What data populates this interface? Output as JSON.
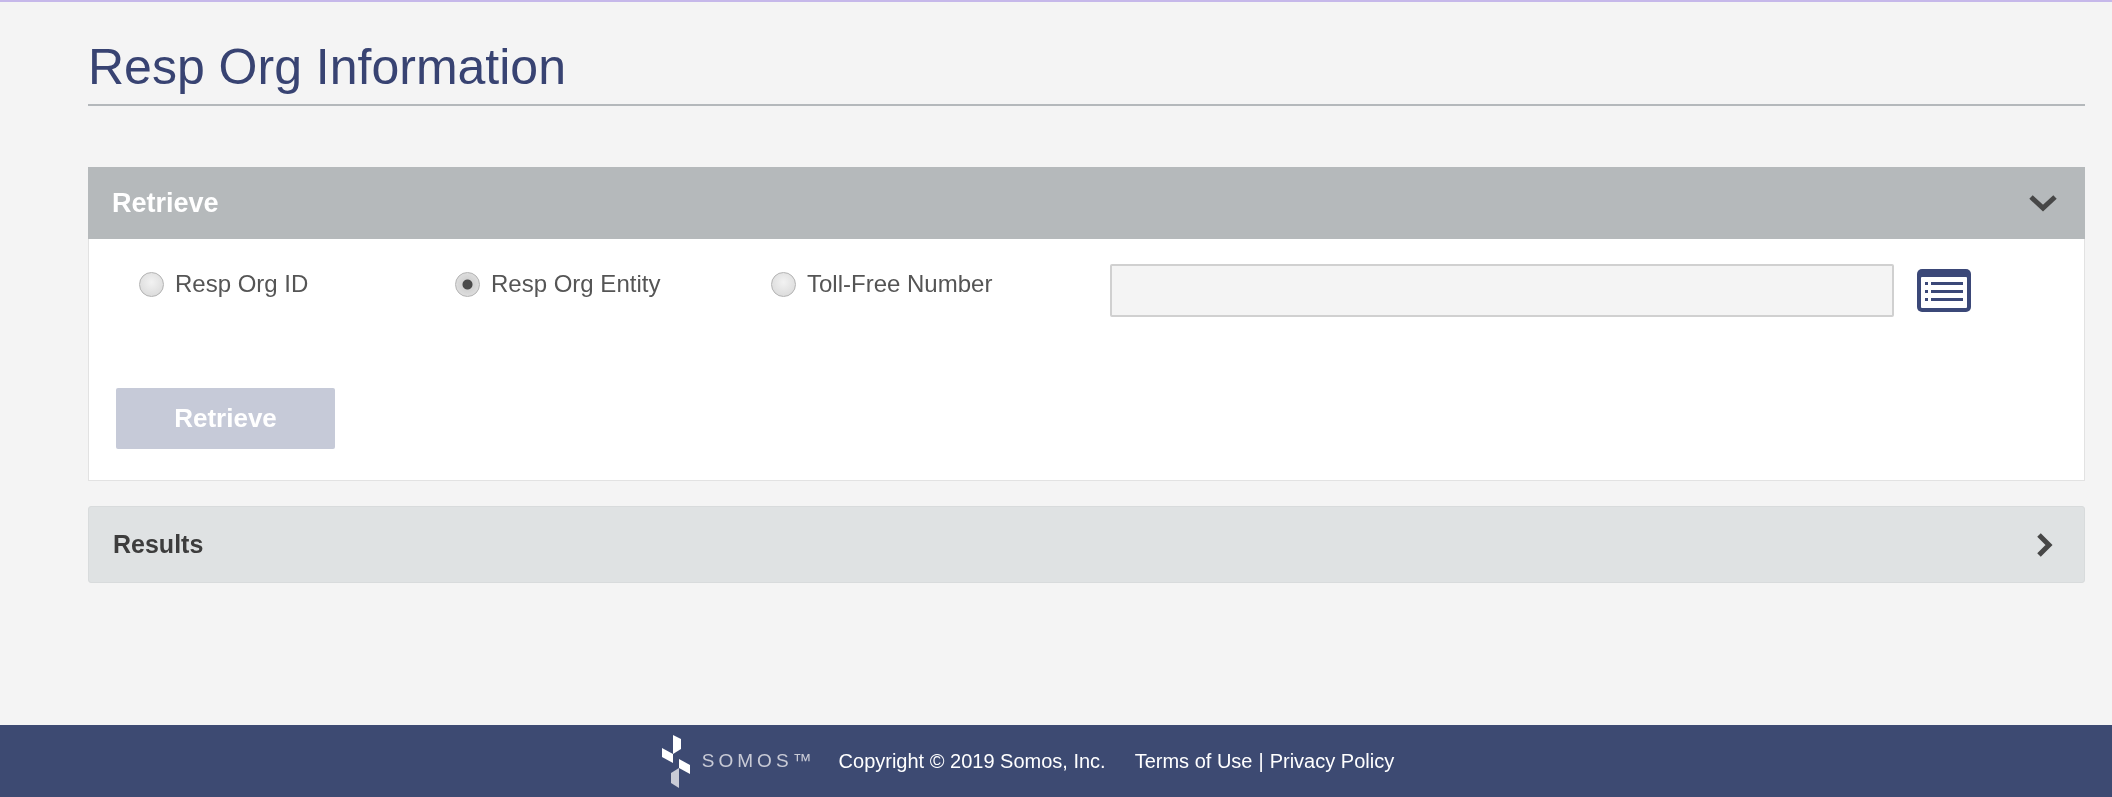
{
  "page": {
    "title": "Resp Org Information"
  },
  "retrieve_panel": {
    "title": "Retrieve",
    "expanded": true,
    "options": [
      {
        "label": "Resp Org ID",
        "selected": false
      },
      {
        "label": "Resp Org Entity",
        "selected": true
      },
      {
        "label": "Toll-Free Number",
        "selected": false
      }
    ],
    "button": {
      "label": "Retrieve",
      "disabled": true
    }
  },
  "results_panel": {
    "title": "Results",
    "expanded": false
  },
  "footer": {
    "logo": "SOMOS™",
    "copyright": "Copyright © 2019 Somos, Inc.",
    "links": [
      "Terms of Use",
      "Privacy Policy"
    ],
    "separator": "|"
  }
}
